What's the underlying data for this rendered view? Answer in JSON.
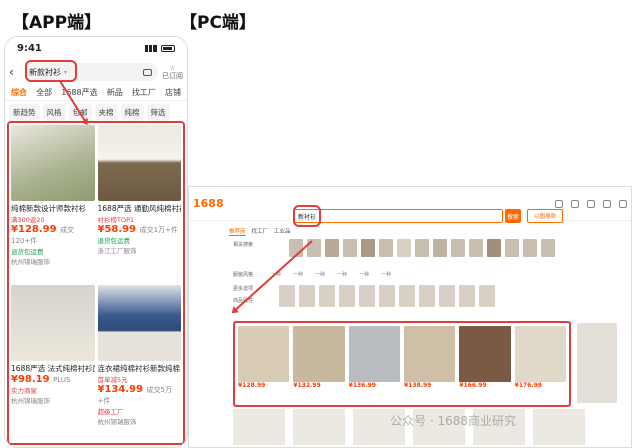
{
  "headings": {
    "app": "【APP端】",
    "pc": "【PC端】"
  },
  "app": {
    "time": "9:41",
    "search": "新款衬衫",
    "subscribe": "已订阅",
    "tabs": [
      "综合",
      "全部",
      "1688严选",
      "新品",
      "找工厂",
      "店铺"
    ],
    "filters": [
      "新趋势",
      "风格",
      "包邮",
      "夹棉",
      "纯棉",
      "筛选"
    ],
    "products": [
      {
        "title": "纯棉新款设计师款衬衫",
        "sub": "满300返20",
        "price": "128.99",
        "sold": "成交120+件",
        "g": "退货包运费",
        "shop": "杭州锦瑞服饰"
      },
      {
        "title": "1688严选 通勤风纯棉衬衫新款",
        "sub": "衬衫榜TOP1",
        "price": "58.99",
        "sold": "成交1万+件",
        "g": "退货包运费",
        "shop": "浙江工厂服饰"
      },
      {
        "title": "1688严选 法式纯棉衬衫面料",
        "sub": "",
        "price": "98.19",
        "sold": "PLUS",
        "g": "实力商家",
        "shop": "杭州锦瑞服饰"
      },
      {
        "title": "连衣裙纯棉衬衫新款纯棉",
        "sub": "首单减5元",
        "price": "134.99",
        "sold": "成交5万+件",
        "g": "超级工厂",
        "shop": "杭州锦瑞服饰"
      }
    ]
  },
  "pc": {
    "logo": "1688",
    "search": "新衬衫",
    "btn": "搜索",
    "btn2": "以图搜款",
    "tabs": [
      "推荐商",
      "找工厂",
      "工业品"
    ],
    "rows": [
      "相关搜索",
      "服装风格",
      "更多选项",
      "商品属性"
    ],
    "price": "¥128",
    "prices": [
      "¥128.99",
      "¥132.99",
      "¥136.99",
      "¥138.99",
      "¥166.99",
      "¥176.99"
    ]
  },
  "watermark": "公众号 · 1688商业研究"
}
